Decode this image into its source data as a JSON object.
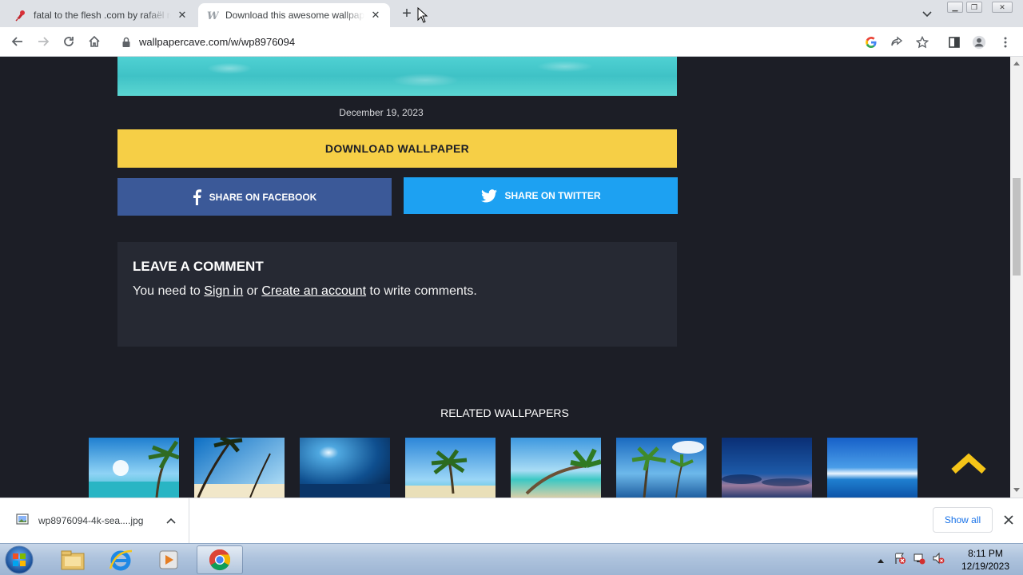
{
  "browser": {
    "tabs": [
      {
        "title": "fatal to the flesh .com by rafaël ro",
        "active": false
      },
      {
        "title": "Download this awesome wallpaper",
        "active": true
      }
    ],
    "url": "wallpapercave.com/w/wp8976094"
  },
  "page": {
    "date": "December 19, 2023",
    "download_label": "DOWNLOAD WALLPAPER",
    "share_facebook": "SHARE ON FACEBOOK",
    "share_twitter": "SHARE ON TWITTER",
    "comment": {
      "title": "LEAVE A COMMENT",
      "prefix": "You need to ",
      "sign_in": "Sign in",
      "or": " or ",
      "create_account": "Create an account",
      "suffix": " to write comments."
    },
    "related_title": "RELATED WALLPAPERS",
    "related_count": 8
  },
  "downloads": {
    "filename": "wp8976094-4k-sea....jpg",
    "show_all": "Show all"
  },
  "taskbar": {
    "time": "8:11 PM",
    "date": "12/19/2023"
  },
  "colors": {
    "page_bg": "#1c1e26",
    "download": "#f6cf46",
    "facebook": "#3b5998",
    "twitter": "#1da1f2",
    "comment_bg": "#262933"
  }
}
